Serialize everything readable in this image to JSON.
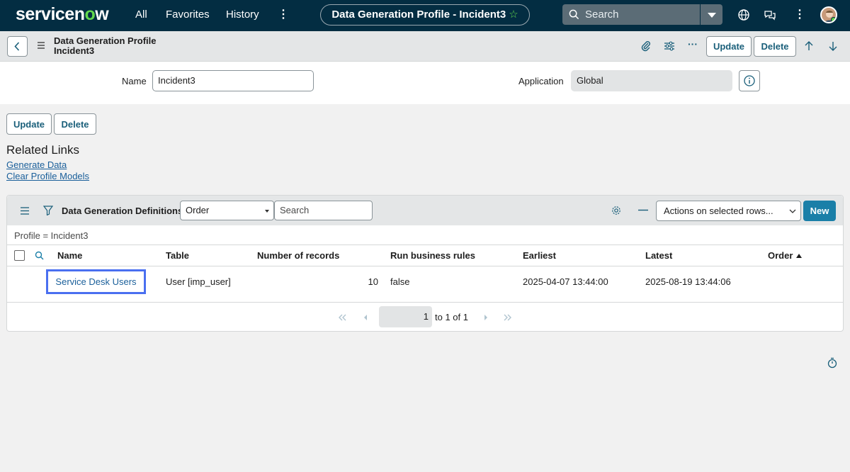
{
  "app": {
    "logo_text_a": "servicen",
    "logo_text_o": "o",
    "logo_text_b": "w",
    "nav": [
      "All",
      "Favorites",
      "History"
    ],
    "page_title": "Data Generation Profile - Incident3",
    "search_placeholder": "Search",
    "accent": "#62d84e",
    "nav_bg": "#032d42"
  },
  "header": {
    "title_line1": "Data Generation Profile",
    "title_line2": "Incident3",
    "update_label": "Update",
    "delete_label": "Delete"
  },
  "form": {
    "name_label": "Name",
    "name_value": "Incident3",
    "application_label": "Application",
    "application_value": "Global"
  },
  "actions": {
    "update_label": "Update",
    "delete_label": "Delete"
  },
  "related_links": {
    "title": "Related Links",
    "links": [
      "Generate Data",
      "Clear Profile Models"
    ]
  },
  "list": {
    "title": "Data Generation Definitions",
    "field_select": "Order",
    "search_placeholder": "Search",
    "actions_select": "Actions on selected rows...",
    "new_label": "New",
    "breadcrumb": "Profile = Incident3",
    "columns": [
      "Name",
      "Table",
      "Number of records",
      "Run business rules",
      "Earliest",
      "Latest",
      "Order"
    ],
    "rows": [
      {
        "name": "Service Desk Users",
        "table": "User [imp_user]",
        "records": "10",
        "business_rules": "false",
        "earliest": "2025-04-07 13:44:00",
        "latest": "2025-08-19 13:44:06",
        "order": ""
      }
    ],
    "pager": {
      "page_value": "1",
      "text": "to 1 of 1"
    }
  }
}
